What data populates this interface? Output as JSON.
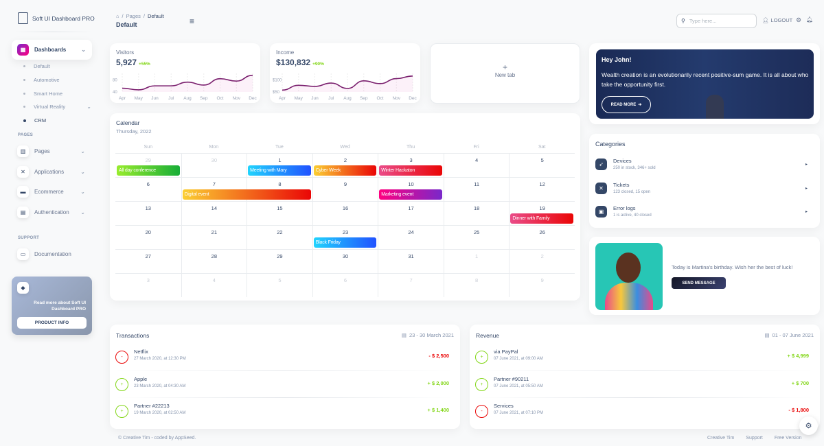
{
  "brand": "Soft UI Dashboard PRO",
  "breadcrumb": {
    "home_icon": "home-icon",
    "section": "Pages",
    "current": "Default",
    "title": "Default"
  },
  "header": {
    "search_placeholder": "Type here...",
    "logout": "LOGOUT"
  },
  "sidebar": {
    "active": "Dashboards",
    "sub_items": [
      "Default",
      "Automotive",
      "Smart Home",
      "Virtual Reality",
      "CRM"
    ],
    "pages_label": "PAGES",
    "items": [
      {
        "label": "Pages",
        "icon": "chart-icon"
      },
      {
        "label": "Applications",
        "icon": "tools-icon"
      },
      {
        "label": "Ecommerce",
        "icon": "basket-icon"
      },
      {
        "label": "Authentication",
        "icon": "document-icon"
      }
    ],
    "support_label": "SUPPORT",
    "documentation": "Documentation",
    "promo": {
      "text": "Read more about Soft UI Dashboard PRO",
      "button": "PRODUCT INFO"
    }
  },
  "visitors": {
    "label": "Visitors",
    "value": "5,927",
    "change": "+55%",
    "y_ticks": [
      "80",
      "40"
    ],
    "chart_data": {
      "type": "line",
      "x": [
        "Apr",
        "May",
        "Jun",
        "Jul",
        "Aug",
        "Sep",
        "Oct",
        "Nov",
        "Dec"
      ],
      "y": [
        44,
        38,
        53,
        53,
        67,
        56,
        80,
        71,
        93
      ],
      "ylim": [
        30,
        100
      ]
    }
  },
  "income": {
    "label": "Income",
    "value": "$130,832",
    "change": "+90%",
    "y_ticks": [
      "$100",
      "$50"
    ],
    "chart_data": {
      "type": "line",
      "x": [
        "Apr",
        "May",
        "Jun",
        "Jul",
        "Aug",
        "Sep",
        "Oct",
        "Nov",
        "Dec"
      ],
      "y": [
        50,
        76,
        70,
        88,
        59,
        100,
        85,
        112,
        126
      ],
      "ylim": [
        40,
        140
      ]
    }
  },
  "new_tab": {
    "label": "New tab"
  },
  "hero": {
    "title": "Hey John!",
    "text": "Wealth creation is an evolutionarily recent positive-sum game. It is all about who take the opportunity first.",
    "button": "READ MORE"
  },
  "categories": {
    "title": "Categories",
    "items": [
      {
        "name": "Devices",
        "detail": "250 in stock, 346+ sold"
      },
      {
        "name": "Tickets",
        "detail": "123 closed, 15 open"
      },
      {
        "name": "Error logs",
        "detail": "1 is active, 40 closed"
      }
    ]
  },
  "birthday": {
    "text": "Today is Martina's birthday. Wish her the best of luck!",
    "button": "SEND MESSAGE"
  },
  "calendar": {
    "title": "Calendar",
    "subtitle": "Thursday, 2022",
    "days": [
      "Sun",
      "Mon",
      "Tue",
      "Wed",
      "Thu",
      "Fri",
      "Sat"
    ],
    "weeks": [
      [
        "29",
        "30",
        "1",
        "2",
        "3",
        "4",
        "5"
      ],
      [
        "6",
        "7",
        "8",
        "9",
        "10",
        "11",
        "12"
      ],
      [
        "13",
        "14",
        "15",
        "16",
        "17",
        "18",
        "19"
      ],
      [
        "20",
        "21",
        "22",
        "23",
        "24",
        "25",
        "26"
      ],
      [
        "27",
        "28",
        "29",
        "30",
        "31",
        "1",
        "2"
      ],
      [
        "3",
        "4",
        "5",
        "6",
        "7",
        "8",
        "9"
      ]
    ],
    "events": [
      {
        "title": "All day conference",
        "week": 0,
        "day": 0,
        "span": 1,
        "colors": [
          "#98ec2d",
          "#17ad37"
        ]
      },
      {
        "title": "Meeting with Mary",
        "week": 0,
        "day": 2,
        "span": 1,
        "colors": [
          "#21d4fd",
          "#2152ff"
        ]
      },
      {
        "title": "Cyber Week",
        "week": 0,
        "day": 3,
        "span": 1,
        "colors": [
          "#fbcf33",
          "#ea0606"
        ]
      },
      {
        "title": "Winter Hackaton",
        "week": 0,
        "day": 4,
        "span": 1,
        "colors": [
          "#ea4c89",
          "#ea0606"
        ]
      },
      {
        "title": "Digital event",
        "week": 1,
        "day": 1,
        "span": 2,
        "colors": [
          "#fbcf33",
          "#ea0606"
        ]
      },
      {
        "title": "Marketing event",
        "week": 1,
        "day": 4,
        "span": 1,
        "colors": [
          "#ff0080",
          "#7928ca"
        ]
      },
      {
        "title": "Dinner with Family",
        "week": 2,
        "day": 6,
        "span": 1,
        "colors": [
          "#ea4c89",
          "#ea0606"
        ]
      },
      {
        "title": "Black Friday",
        "week": 3,
        "day": 3,
        "span": 1,
        "colors": [
          "#21d4fd",
          "#2152ff"
        ]
      }
    ]
  },
  "transactions": {
    "title": "Transactions",
    "range": "23 - 30 March 2021",
    "items": [
      {
        "name": "Netflix",
        "date": "27 March 2020, at 12:30 PM",
        "amount": "- $ 2,500",
        "type": "out"
      },
      {
        "name": "Apple",
        "date": "23 March 2020, at 04:30 AM",
        "amount": "+ $ 2,000",
        "type": "in"
      },
      {
        "name": "Partner #22213",
        "date": "19 March 2020, at 02:50 AM",
        "amount": "+ $ 1,400",
        "type": "in"
      }
    ]
  },
  "revenue": {
    "title": "Revenue",
    "range": "01 - 07 June 2021",
    "items": [
      {
        "name": "via PayPal",
        "date": "07 June 2021, at 09:00 AM",
        "amount": "+ $ 4,999",
        "type": "in"
      },
      {
        "name": "Partner #90211",
        "date": "07 June 2021, at 05:50 AM",
        "amount": "+ $ 700",
        "type": "in"
      },
      {
        "name": "Services",
        "date": "07 June 2021, at 07:10 PM",
        "amount": "- $ 1,800",
        "type": "out"
      }
    ]
  },
  "footer": {
    "copyright": "© Creative Tim - coded by AppSeed.",
    "links": [
      "Creative Tim",
      "Support",
      "Free Version"
    ]
  },
  "colors": {
    "positive": "#82d616",
    "negative": "#ea0606",
    "accent": "#cb0c9f"
  }
}
